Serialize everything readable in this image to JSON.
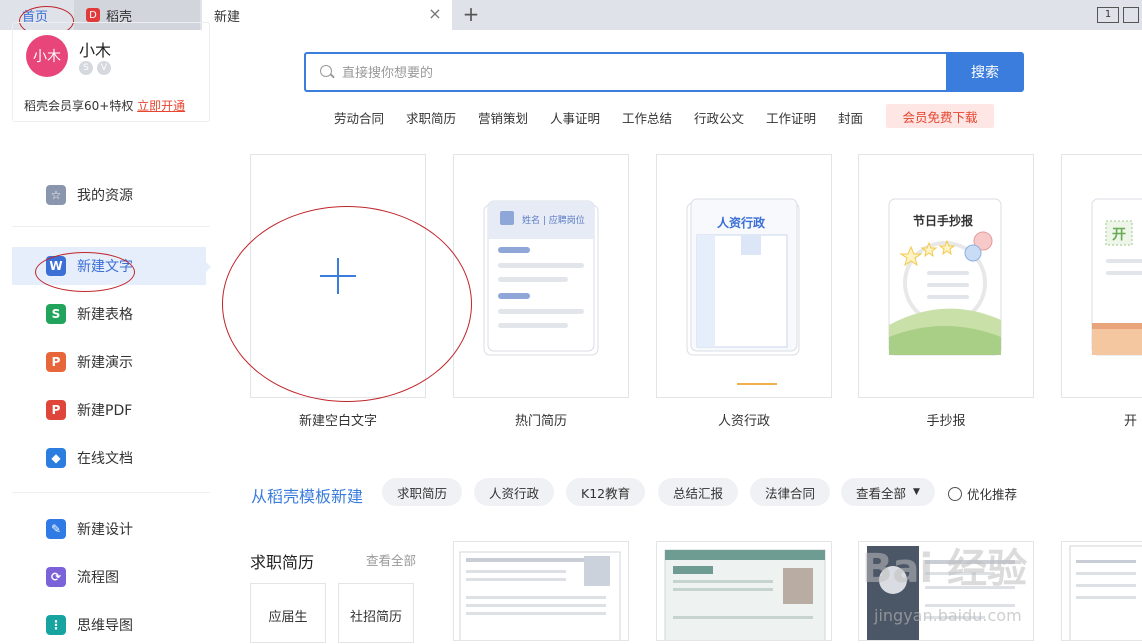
{
  "tabs": {
    "home": "首页",
    "daoke": "稻壳",
    "daoke_logo": "D",
    "new_tab": "新建",
    "close_glyph": "×",
    "add_glyph": "+",
    "window_icons": [
      "1",
      ""
    ]
  },
  "user": {
    "avatar_text": "小木",
    "name": "小木",
    "badges": [
      "S",
      "V"
    ],
    "vip_text": "稻壳会员享60+特权",
    "vip_link": "立即开通"
  },
  "sidebar": {
    "items": [
      {
        "label": "我的资源",
        "icon": "star-icon",
        "icon_text": "☆",
        "color": "#8a96ad"
      },
      {
        "label": "新建文字",
        "icon": "writer-icon",
        "icon_text": "W",
        "color": "#3b6fd6"
      },
      {
        "label": "新建表格",
        "icon": "spreadsheet-icon",
        "icon_text": "S",
        "color": "#22a45c"
      },
      {
        "label": "新建演示",
        "icon": "presentation-icon",
        "icon_text": "P",
        "color": "#e8673a"
      },
      {
        "label": "新建PDF",
        "icon": "pdf-icon",
        "icon_text": "P",
        "color": "#e0453c"
      },
      {
        "label": "在线文档",
        "icon": "cloud-doc-icon",
        "icon_text": "◆",
        "color": "#2b7ee0"
      },
      {
        "label": "新建设计",
        "icon": "design-icon",
        "icon_text": "✎",
        "color": "#2f7ae5"
      },
      {
        "label": "流程图",
        "icon": "flowchart-icon",
        "icon_text": "⟳",
        "color": "#7b62d9"
      },
      {
        "label": "思维导图",
        "icon": "mindmap-icon",
        "icon_text": "⋮",
        "color": "#17a3a0"
      }
    ]
  },
  "search": {
    "placeholder": "直接搜你想要的",
    "button": "搜索",
    "hot_links": [
      "劳动合同",
      "求职简历",
      "营销策划",
      "人事证明",
      "工作总结",
      "行政公文",
      "工作证明",
      "封面"
    ],
    "vip_download": "会员免费下载"
  },
  "cards": {
    "blank": "新建空白文字",
    "resume": "热门简历",
    "hr": "人资行政",
    "handwrite": "手抄报",
    "partial": "开"
  },
  "card_art": {
    "resume_header": "姓名 | 应聘岗位",
    "hr_title": "人资行政",
    "handwrite_title": "节日手抄报",
    "partial_title": "开"
  },
  "templates": {
    "section_title": "从稻壳模板新建",
    "chips": [
      "求职简历",
      "人资行政",
      "K12教育",
      "总结汇报",
      "法律合同"
    ],
    "view_all_chip": "查看全部",
    "optimize": "优化推荐"
  },
  "resume_section": {
    "title": "求职简历",
    "view_all": "查看全部",
    "categories": [
      "应届生",
      "社招简历"
    ]
  },
  "watermark": {
    "main": "Bai 经验",
    "sub": "jingyan.baidu.com"
  }
}
